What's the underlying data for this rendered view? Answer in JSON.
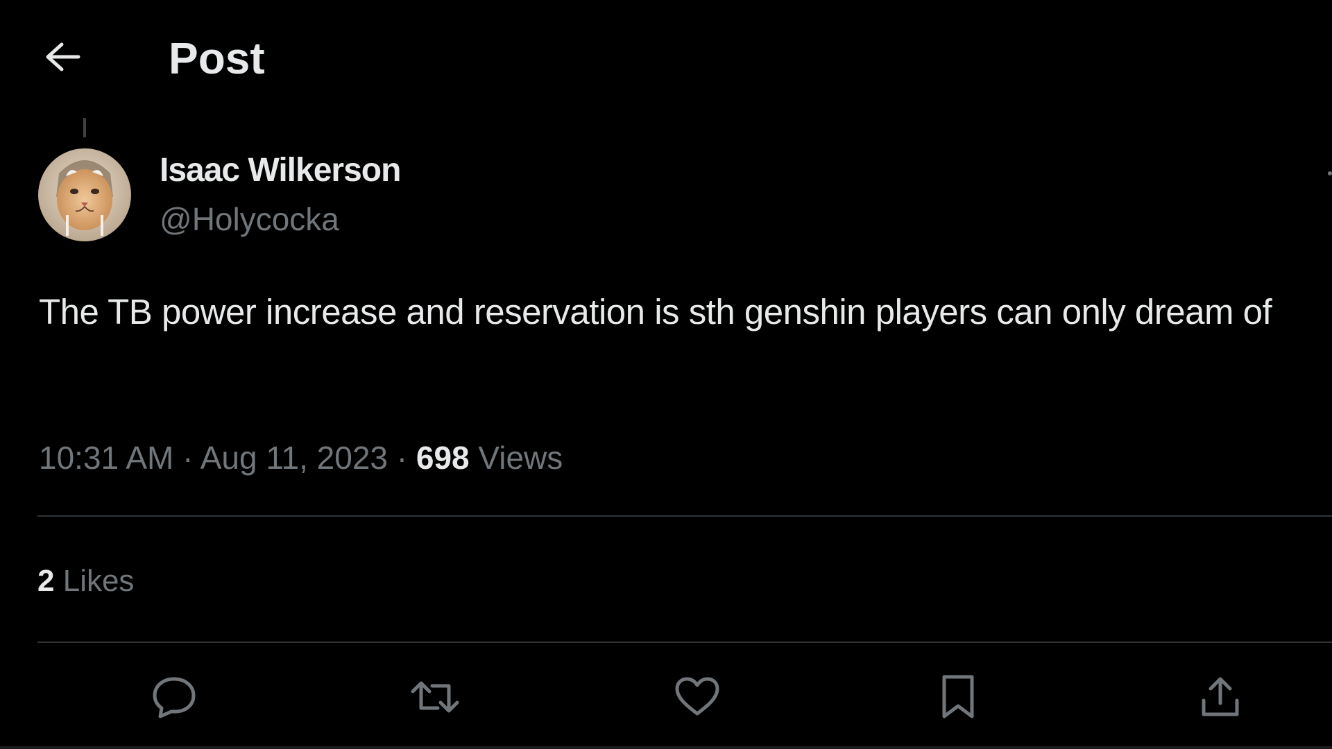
{
  "header": {
    "back_icon": "arrow-left-icon",
    "title": "Post"
  },
  "tweet": {
    "author": {
      "display_name": "Isaac Wilkerson",
      "handle": "@Holycocka",
      "avatar_icon": "cat-avatar"
    },
    "more_icon": "more-dots-icon",
    "text": "The TB power increase and reservation is sth genshin players can only dream of",
    "time": "10:31 AM",
    "separator": "·",
    "date": "Aug 11, 2023",
    "views_count": "698",
    "views_label": "Views",
    "likes_count": "2",
    "likes_label": "Likes"
  },
  "actions": [
    {
      "id": "reply",
      "icon": "reply-icon"
    },
    {
      "id": "repost",
      "icon": "repost-icon"
    },
    {
      "id": "like",
      "icon": "heart-icon"
    },
    {
      "id": "bookmark",
      "icon": "bookmark-icon"
    },
    {
      "id": "share",
      "icon": "share-icon"
    }
  ],
  "colors": {
    "background": "#000000",
    "primary_text": "#e7e9ea",
    "secondary_text": "#71767b",
    "divider": "#2f3336"
  }
}
